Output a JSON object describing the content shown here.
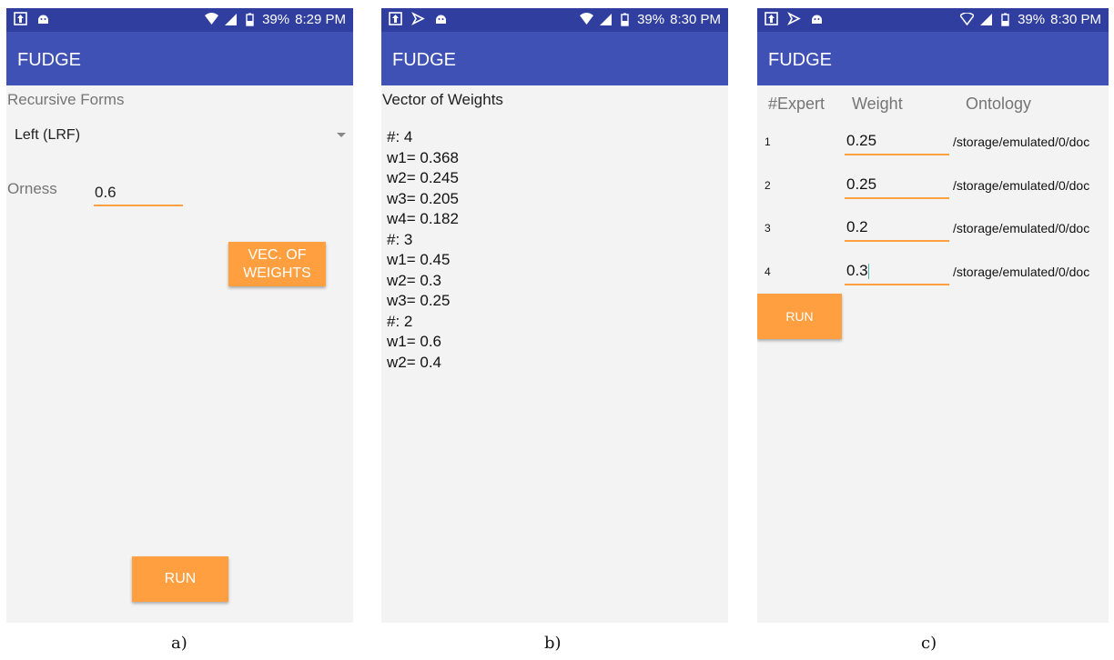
{
  "status_a": {
    "battery": "39%",
    "time": "8:29 PM"
  },
  "status_b": {
    "battery": "39%",
    "time": "8:30 PM"
  },
  "status_c": {
    "battery": "39%",
    "time": "8:30 PM"
  },
  "app_title": "FUDGE",
  "screen_a": {
    "recursive_label": "Recursive Forms",
    "recursive_value": "Left (LRF)",
    "orness_label": "Orness",
    "orness_value": "0.6",
    "vec_button_line1": "VEC. OF",
    "vec_button_line2": "WEIGHTS",
    "run_button": "RUN"
  },
  "screen_b": {
    "heading": "Vector of Weights",
    "lines": [
      "#: 4",
      "w1= 0.368",
      "w2= 0.245",
      "w3= 0.205",
      "w4= 0.182",
      "#: 3",
      "w1= 0.45",
      "w2= 0.3",
      "w3= 0.25",
      "#: 2",
      "w1= 0.6",
      "w2= 0.4"
    ]
  },
  "screen_c": {
    "col_expert": "#Expert",
    "col_weight": "Weight",
    "col_ontology": "Ontology",
    "rows": [
      {
        "num": "1",
        "weight": "0.25",
        "path": "/storage/emulated/0/doc"
      },
      {
        "num": "2",
        "weight": "0.25",
        "path": "/storage/emulated/0/doc"
      },
      {
        "num": "3",
        "weight": "0.2",
        "path": "/storage/emulated/0/doc"
      },
      {
        "num": "4",
        "weight": "0.3",
        "path": "/storage/emulated/0/doc"
      }
    ],
    "run_button": "RUN"
  },
  "captions": {
    "a": "a)",
    "b": "b)",
    "c": "c)"
  },
  "colors": {
    "statusbar": "#303f9f",
    "appbar": "#3f51b5",
    "accent": "#ff9f3f"
  }
}
